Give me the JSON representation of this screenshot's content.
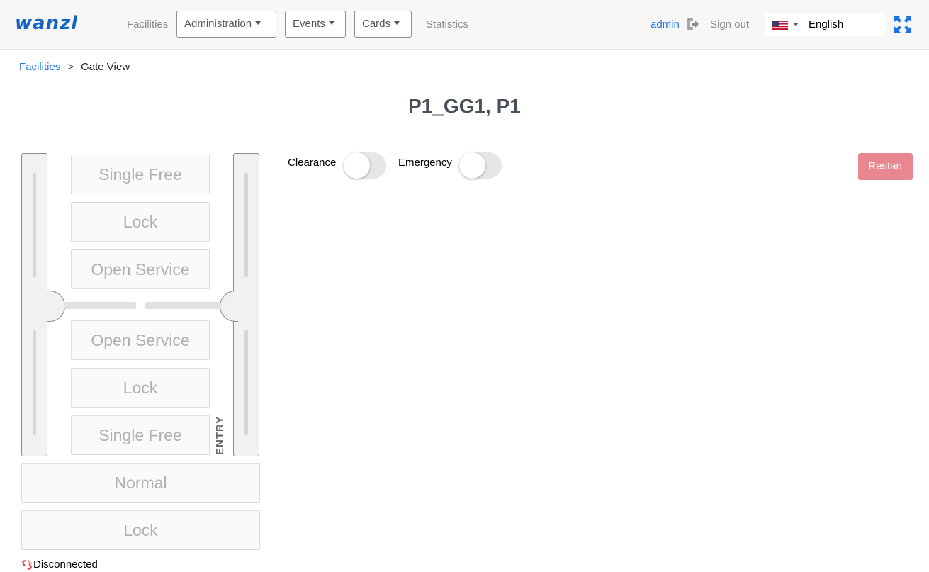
{
  "header": {
    "logo": "wanzl",
    "nav": {
      "facilities": "Facilities",
      "administration": "Administration",
      "events": "Events",
      "cards": "Cards",
      "statistics": "Statistics"
    },
    "user": "admin",
    "signout": "Sign out",
    "language": "English"
  },
  "breadcrumb": {
    "parent": "Facilities",
    "separator": ">",
    "current": "Gate View"
  },
  "title": "P1_GG1, P1",
  "gate": {
    "upper": [
      "Single Free",
      "Lock",
      "Open Service"
    ],
    "lower": [
      "Open Service",
      "Lock",
      "Single Free"
    ],
    "entry": "ENTRY",
    "bottom": [
      "Normal",
      "Lock"
    ]
  },
  "controls": {
    "clearance": "Clearance",
    "emergency": "Emergency",
    "restart": "Restart"
  },
  "status": "Disconnected",
  "colors": {
    "brand": "#1565c0",
    "link": "#1a73e8",
    "restart": "#e8878f"
  }
}
